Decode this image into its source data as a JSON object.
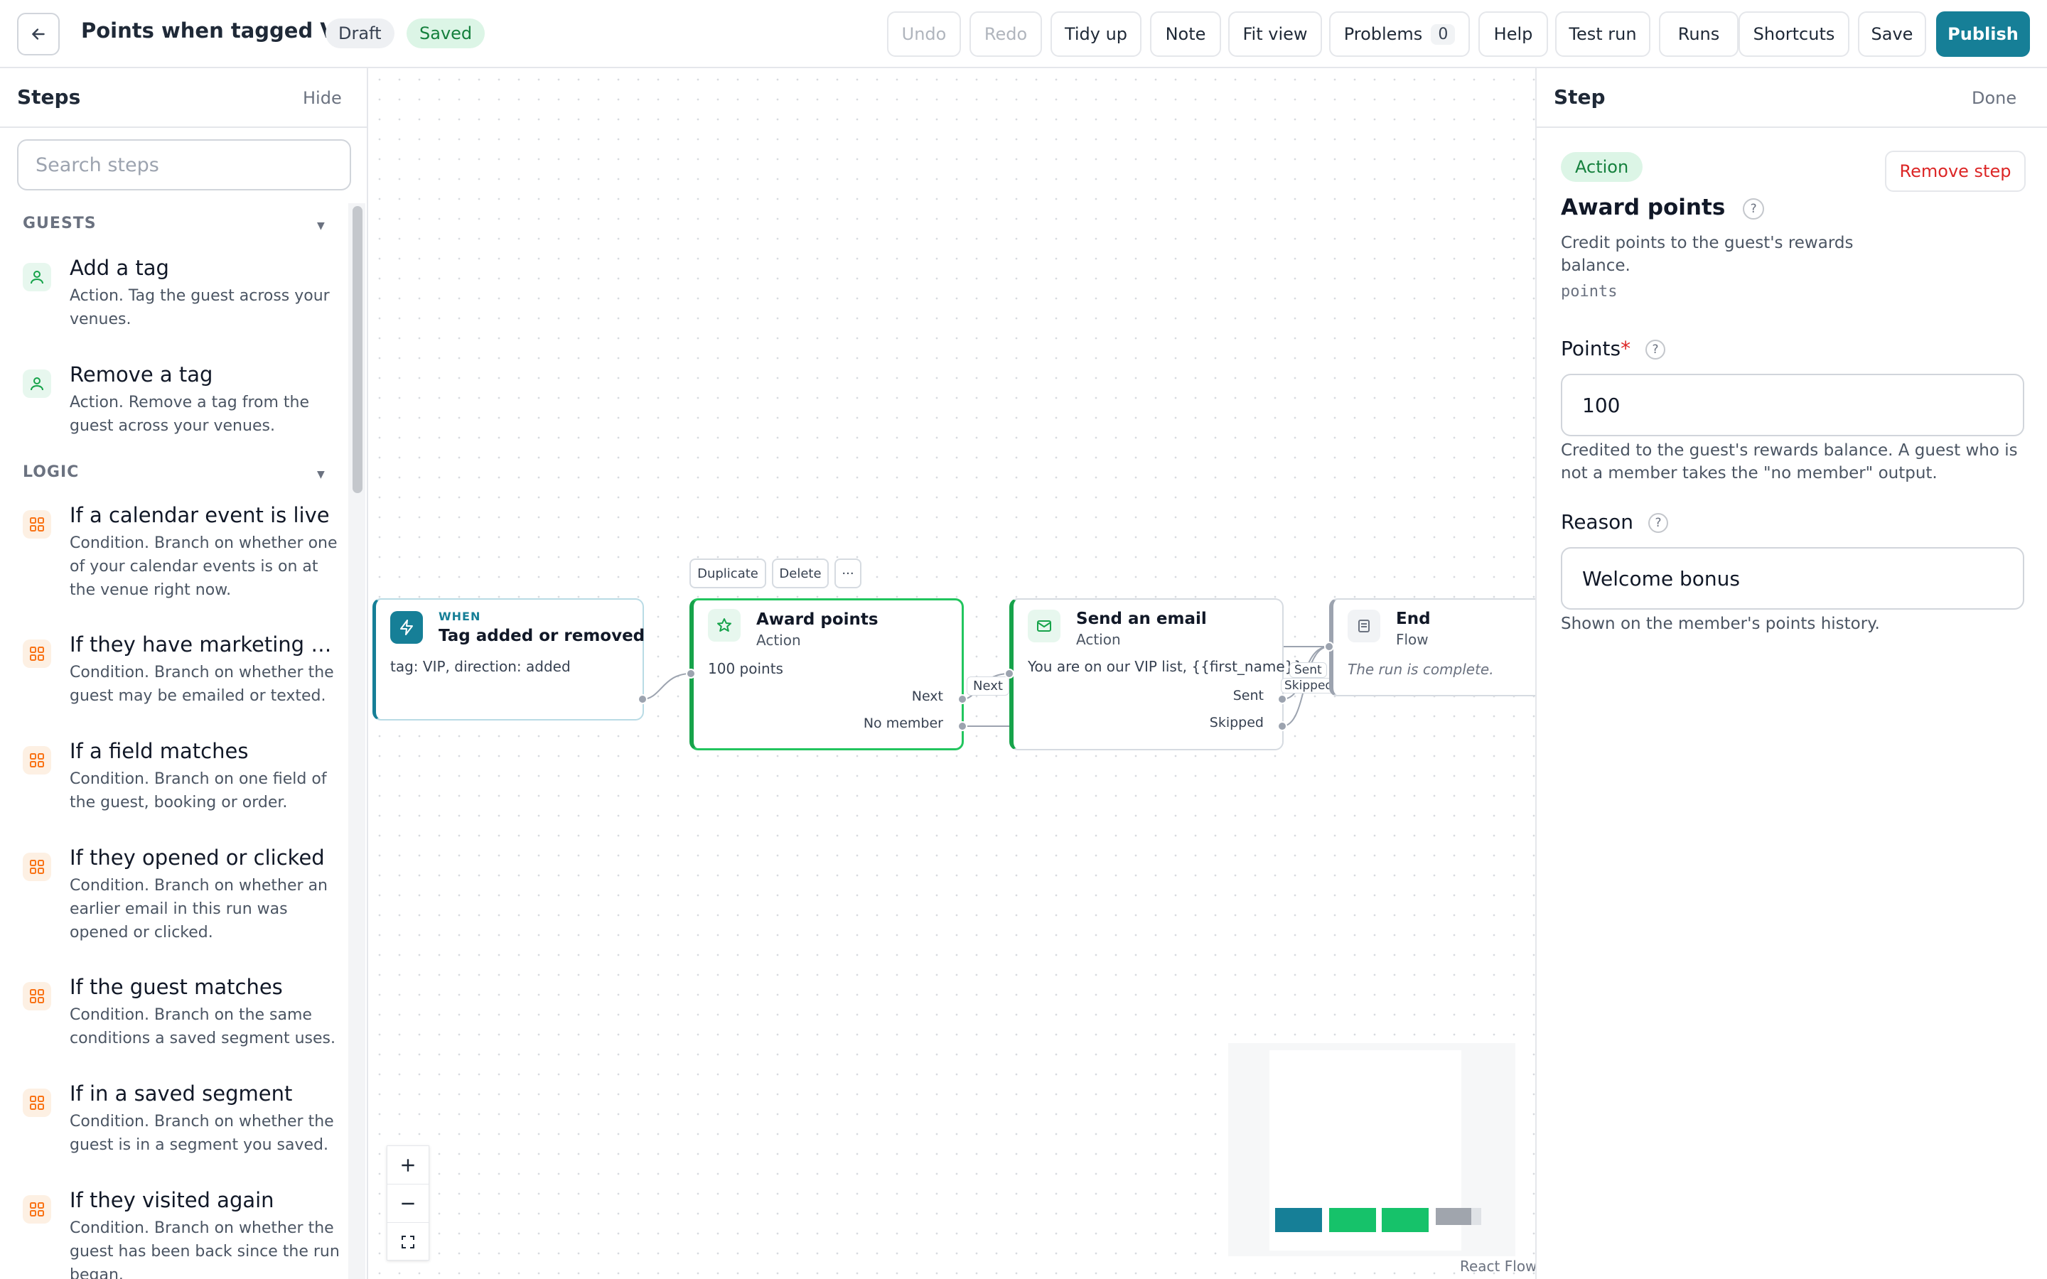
{
  "header": {
    "title": "Points when tagged VIP",
    "status_draft": "Draft",
    "status_saved": "Saved",
    "buttons": {
      "undo": "Undo",
      "redo": "Redo",
      "tidy": "Tidy up",
      "note": "Note",
      "fit": "Fit view",
      "problems": "Problems",
      "problems_count": "0",
      "help": "Help",
      "test_run": "Test run",
      "runs": "Runs",
      "shortcuts": "Shortcuts",
      "save": "Save",
      "publish": "Publish"
    }
  },
  "steps_panel": {
    "title": "Steps",
    "hide": "Hide",
    "search_placeholder": "Search steps",
    "groups": {
      "guests": "GUESTS",
      "logic": "LOGIC"
    },
    "items": [
      {
        "name": "Add a tag",
        "desc": "Action. Tag the guest across your venues.",
        "icon": "user-icon"
      },
      {
        "name": "Remove a tag",
        "desc": "Action. Remove a tag from the guest across your venues.",
        "icon": "user-icon"
      },
      {
        "name": "If a calendar event is live",
        "desc": "Condition. Branch on whether one of your calendar events is on at the venue right now.",
        "icon": "grid-icon"
      },
      {
        "name": "If they have marketing co...",
        "desc": "Condition. Branch on whether the guest may be emailed or texted.",
        "icon": "grid-icon"
      },
      {
        "name": "If a field matches",
        "desc": "Condition. Branch on one field of the guest, booking or order.",
        "icon": "grid-icon"
      },
      {
        "name": "If they opened or clicked",
        "desc": "Condition. Branch on whether an earlier email in this run was opened or clicked.",
        "icon": "grid-icon"
      },
      {
        "name": "If the guest matches",
        "desc": "Condition. Branch on the same conditions a saved segment uses.",
        "icon": "grid-icon"
      },
      {
        "name": "If in a saved segment",
        "desc": "Condition. Branch on whether the guest is in a segment you saved.",
        "icon": "grid-icon"
      },
      {
        "name": "If they visited again",
        "desc": "Condition. Branch on whether the guest has been back since the run began.",
        "icon": "grid-icon"
      }
    ]
  },
  "canvas": {
    "node_toolbar": {
      "duplicate": "Duplicate",
      "delete": "Delete",
      "more": "···"
    },
    "nodes": {
      "trigger": {
        "kicker": "WHEN",
        "title": "Tag added or removed",
        "body": "tag: VIP, direction: added"
      },
      "award": {
        "title": "Award points",
        "type": "Action",
        "body": "100 points",
        "out_next": "Next",
        "out_no_member": "No member"
      },
      "email": {
        "title": "Send an email",
        "type": "Action",
        "body": "You are on our VIP list, {{first_name}}",
        "out_sent": "Sent",
        "out_skipped": "Skipped"
      },
      "end": {
        "title": "End",
        "type": "Flow",
        "body": "The run is complete."
      }
    },
    "edge_labels": {
      "next": "Next",
      "sent": "Sent",
      "skipped": "Skipped"
    },
    "zoom": {
      "in": "+",
      "out": "−",
      "fit": "⛶"
    },
    "attribution": "React Flow"
  },
  "step_panel": {
    "title": "Step",
    "done": "Done",
    "badge": "Action",
    "remove": "Remove step",
    "step_name": "Award points",
    "description": "Credit points to the guest's rewards balance.",
    "code": "points",
    "fields": {
      "points_label": "Points",
      "points_value": "100",
      "points_help": "Credited to the guest's rewards balance. A guest who is not a member takes the \"no member\" output.",
      "reason_label": "Reason",
      "reason_value": "Welcome bonus",
      "reason_help": "Shown on the member's points history."
    }
  },
  "colors": {
    "accent": "#167f97",
    "green": "#16a34a",
    "danger": "#dc2626"
  }
}
